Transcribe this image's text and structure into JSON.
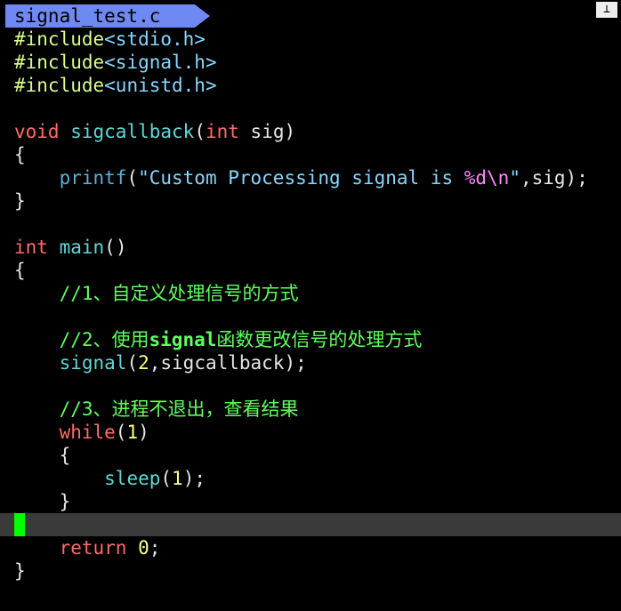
{
  "tab": {
    "title": "signal_test.c",
    "close_glyph": "⊥"
  },
  "colors": {
    "tab_bg": "#6f89f3",
    "cursor": "#00ff00",
    "keyword": "#ff6b6b",
    "function": "#5fd7d7",
    "string": "#87d7ff",
    "comment": "#5fff5f",
    "number": "#ffff87"
  },
  "code": {
    "l1_inc": "#include",
    "l1_hdr": "<stdio.h>",
    "l2_inc": "#include",
    "l2_hdr": "<signal.h>",
    "l3_inc": "#include",
    "l3_hdr": "<unistd.h>",
    "l5_kw": "void",
    "l5_fn": "sigcallback",
    "l5_p1": "(",
    "l5_kw2": "int",
    "l5_rest": " sig)",
    "l6": "{",
    "l7_fn": "printf",
    "l7_p1": "(",
    "l7_str1": "\"Custom Processing signal is ",
    "l7_fmt": "%d\\n",
    "l7_str2": "\"",
    "l7_rest": ",sig);",
    "l8": "}",
    "l10_kw": "int",
    "l10_fn": "main",
    "l10_rest": "()",
    "l11": "{",
    "l12_cmt": "//1、自定义处理信号的方式",
    "l14_cmt1": "//2、使用",
    "l14_cmt_bold": "signal",
    "l14_cmt2": "函数更改信号的处理方式",
    "l15_fn": "signal",
    "l15_p1": "(",
    "l15_num": "2",
    "l15_rest": ",sigcallback);",
    "l17_cmt": "//3、进程不退出，查看结果",
    "l18_kw": "while",
    "l18_p1": "(",
    "l18_num": "1",
    "l18_p2": ")",
    "l19": "{",
    "l20_fn": "sleep",
    "l20_p1": "(",
    "l20_num": "1",
    "l20_rest": ");",
    "l21": "}",
    "l23_kw": "return",
    "l23_num": "0",
    "l23_rest": ";",
    "l24": "}"
  }
}
